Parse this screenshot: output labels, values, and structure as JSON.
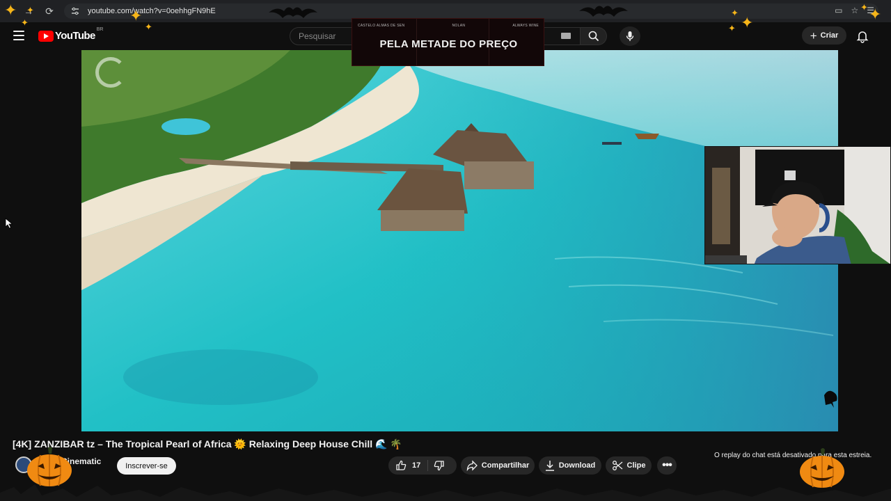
{
  "browser": {
    "url": "youtube.com/watch?v=0oehhgFN9hE"
  },
  "masthead": {
    "logo_text": "YouTube",
    "country_code": "BR",
    "search_placeholder": "Pesquisar",
    "create_label": "Criar"
  },
  "banner": {
    "small_labels": [
      "CASTELO ALMAS DE SEN",
      "NOLAN",
      "ALWAYS WINE"
    ],
    "headline": "PELA METADE DO PREÇO"
  },
  "video": {
    "title": "[4K] ZANZIBAR tz – The Tropical Pearl of Africa 🌞 Relaxing Deep House Chill 🌊 🌴",
    "channel": "Cinematic",
    "subscribe_label": "Inscrever-se",
    "likes": "17",
    "share_label": "Compartilhar",
    "download_label": "Download",
    "clip_label": "Clipe",
    "more_label": "•••"
  },
  "chat": {
    "replay_message": "O replay do chat está desativado para esta estreia."
  },
  "colors": {
    "background": "#0f0f0f",
    "brand_red": "#ff0000",
    "accent_gold": "#f6b519",
    "pumpkin_orange": "#f08a12"
  }
}
